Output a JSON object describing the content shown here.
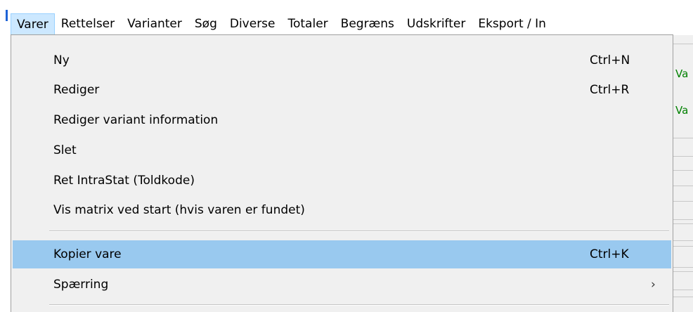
{
  "theme": {
    "accent": "#1e63d6",
    "highlight": "#99c9ef",
    "menu_background": "#f0f0f0",
    "open_menu_background": "#cce8ff",
    "green_label": "#008000"
  },
  "menubar": {
    "items": [
      {
        "label": "Varer",
        "open": true
      },
      {
        "label": "Rettelser"
      },
      {
        "label": "Varianter"
      },
      {
        "label": "Søg"
      },
      {
        "label": "Diverse"
      },
      {
        "label": "Totaler"
      },
      {
        "label": "Begræns"
      },
      {
        "label": "Udskrifter"
      },
      {
        "label": "Eksport / In"
      }
    ]
  },
  "dropdown": {
    "items": [
      {
        "label": "Ny",
        "shortcut": "Ctrl+N"
      },
      {
        "label": "Rediger",
        "shortcut": "Ctrl+R"
      },
      {
        "label": "Rediger variant information",
        "shortcut": ""
      },
      {
        "label": "Slet",
        "shortcut": ""
      },
      {
        "label": "Ret IntraStat (Toldkode)",
        "shortcut": ""
      },
      {
        "label": "Vis matrix ved start (hvis varen er fundet)",
        "shortcut": ""
      },
      {
        "label": "Kopier vare",
        "shortcut": "Ctrl+K",
        "highlighted": true
      },
      {
        "label": "Spærring",
        "shortcut": "",
        "submenu_arrow": "›"
      }
    ]
  },
  "background_window": {
    "labels": [
      "Va",
      "Va"
    ]
  }
}
